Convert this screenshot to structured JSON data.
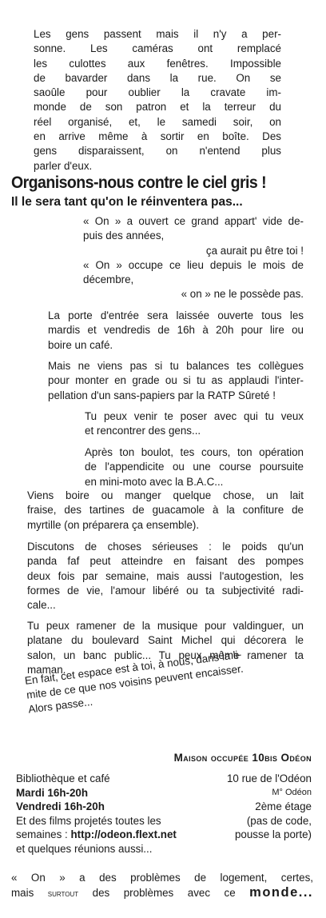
{
  "intro": [
    "Les gens passent mais il n'y a per-",
    "sonne. Les caméras ont remplacé",
    "les culottes aux fenêtres. Impossible",
    "de bavarder dans la rue. On se",
    "saoûle pour oublier la cravate im-",
    "monde de son patron et la terreur du",
    "réel organisé, et, le samedi soir, on",
    "en arrive même à sortir en boîte. Des",
    "gens disparaissent, on n'entend plus",
    "parler d'eux."
  ],
  "title": "Organisons-nous contre le ciel gris !",
  "subtitle": "Il le sera tant qu'on le réinventera pas...",
  "quote": [
    "« On » a ouvert ce grand appart' vide de-",
    "puis des années,",
    "ça aurait pu être toi !",
    "« On » occupe ce lieu depuis le mois de",
    "décembre,",
    "« on » ne le possède pas."
  ],
  "porte": [
    "La porte d'entrée sera laissée ouverte tous les",
    "mardis et vendredis de 16h à 20h pour lire ou",
    "boire un café."
  ],
  "mais": [
    "Mais ne viens pas si tu balances tes collègues",
    "pour monter en grade ou si tu as applaudi l'inter-",
    "pellation d'un sans-papiers par la RATP Sûreté !"
  ],
  "tupeux": [
    "Tu peux venir te poser avec qui tu veux",
    "et rencontrer des gens..."
  ],
  "apres": [
    "Après ton boulot, tes cours, ton opération",
    "de l'appendicite ou une course poursuite",
    "en mini-moto avec la B.A.C..."
  ],
  "viens": [
    "Viens boire ou manger quelque chose, un lait",
    "fraise, des tartines de guacamole à la confiture de",
    "myrtille (on préparera ça ensemble)."
  ],
  "discutons": [
    "Discutons de choses sérieuses : le poids qu'un",
    "panda faf peut atteindre en faisant des pompes",
    "deux fois par semaine, mais aussi l'autogestion, les",
    "formes de vie, l'amour libéré ou ta subjectivité radi-",
    "cale..."
  ],
  "musique": [
    "Tu peux ramener de la musique pour valdinguer, un",
    "platane du boulevard Saint Michel qui décorera le",
    "salon, un banc public... Tu peux même ramener ta",
    "maman."
  ],
  "tilted": [
    "En fait, cet espace est à toi, à nous, dans la li-",
    "mite de ce que nos voisins peuvent encaisser.",
    "Alors passe..."
  ],
  "heading": "Maison occupée 10bis Odéon",
  "info": {
    "line1": "Bibliothèque et café",
    "line2": "Mardi 16h-20h",
    "line3": "Vendredi 16h-20h",
    "line4": "Et des films projetés toutes les",
    "line5_prefix": "semaines : ",
    "url": "http://odeon.flext.net",
    "line6": "et quelques réunions aussi..."
  },
  "address": {
    "street": "10 rue de l'Odéon",
    "metro": "M° Odéon",
    "floor": "2ème étage",
    "code1": "(pas de code,",
    "code2": "pousse la porte)"
  },
  "footer": {
    "line1": "« On » a des problèmes de logement, certes,",
    "line2_prefix": "mais ",
    "surtout": "surtout",
    "line2_mid": " des problèmes avec ce ",
    "monde": "monde..."
  }
}
